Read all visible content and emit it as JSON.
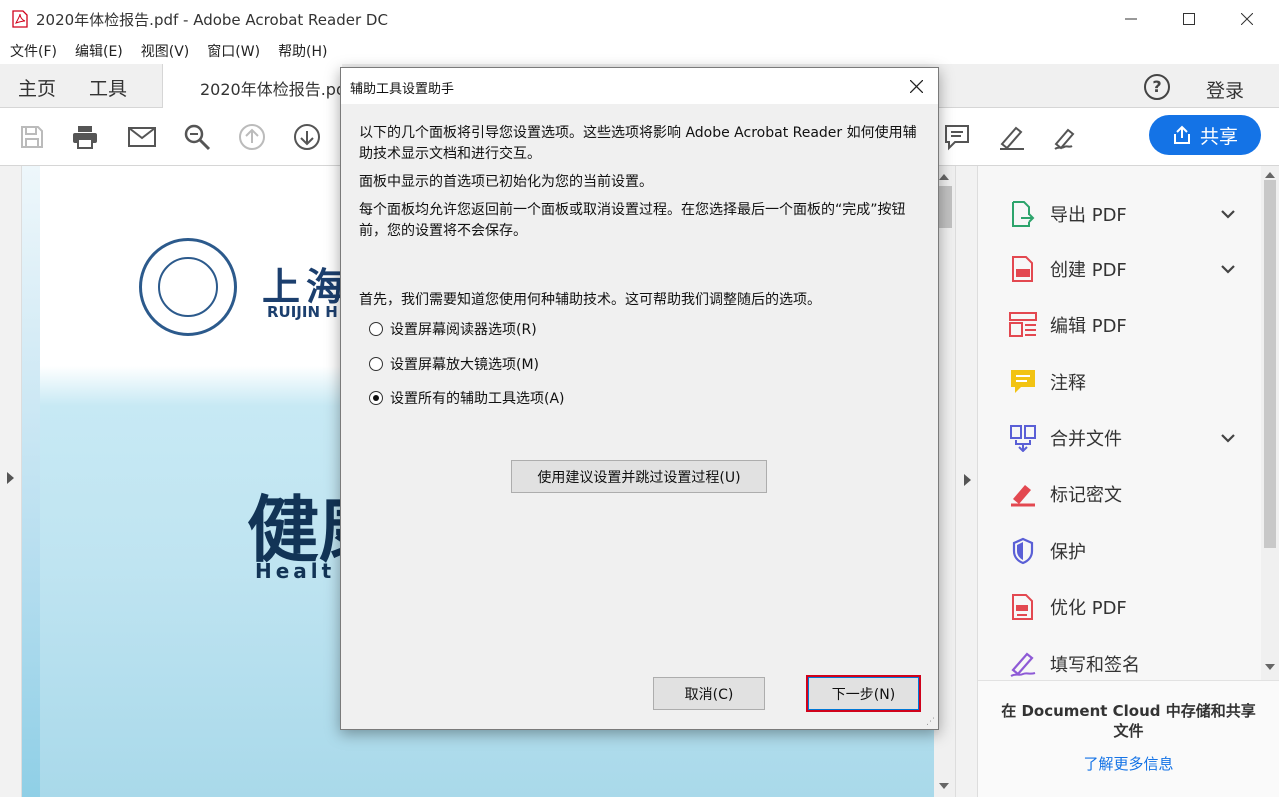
{
  "window": {
    "title": "2020年体检报告.pdf - Adobe Acrobat Reader DC",
    "minimize": "—",
    "maximize": "☐",
    "close": "✕"
  },
  "menu": [
    "文件(F)",
    "编辑(E)",
    "视图(V)",
    "窗口(W)",
    "帮助(H)"
  ],
  "tabs": {
    "home": "主页",
    "tools": "工具",
    "document": "2020年体检报告.pdf",
    "help": "?",
    "login": "登录"
  },
  "toolbar": {
    "icons": [
      "save-icon",
      "print-icon",
      "email-icon",
      "zoom-search-icon",
      "page-up-icon",
      "page-down-icon",
      "comment-icon",
      "highlight-pen-icon",
      "sign-icon"
    ],
    "share_label": "共享",
    "accent": "#1473e6"
  },
  "document": {
    "hospital_cn": "上海",
    "hospital_en": "RUIJIN H",
    "title_cn": "健康",
    "title_en": "Healt"
  },
  "dialog": {
    "title": "辅助工具设置助手",
    "para1": "以下的几个面板将引导您设置选项。这些选项将影响 Adobe Acrobat Reader 如何使用辅助技术显示文档和进行交互。",
    "para2": "面板中显示的首选项已初始化为您的当前设置。",
    "para3": "每个面板均允许您返回前一个面板或取消设置过程。在您选择最后一个面板的“完成”按钮前，您的设置将不会保存。",
    "question": "首先，我们需要知道您使用何种辅助技术。这可帮助我们调整随后的选项。",
    "options": [
      {
        "label": "设置屏幕阅读器选项(R)",
        "selected": false
      },
      {
        "label": "设置屏幕放大镜选项(M)",
        "selected": false
      },
      {
        "label": "设置所有的辅助工具选项(A)",
        "selected": true
      }
    ],
    "skip_button": "使用建议设置并跳过设置过程(U)",
    "cancel_button": "取消(C)",
    "next_button": "下一步(N)"
  },
  "right_panel": {
    "items": [
      {
        "label": "导出 PDF",
        "icon": "export-pdf-icon",
        "color": "#2da46c",
        "expandable": true
      },
      {
        "label": "创建 PDF",
        "icon": "create-pdf-icon",
        "color": "#e34850",
        "expandable": true
      },
      {
        "label": "编辑 PDF",
        "icon": "edit-pdf-icon",
        "color": "#e34850",
        "expandable": false
      },
      {
        "label": "注释",
        "icon": "comment-icon",
        "color": "#f2c313",
        "expandable": false
      },
      {
        "label": "合并文件",
        "icon": "combine-files-icon",
        "color": "#5a5fd6",
        "expandable": true
      },
      {
        "label": "标记密文",
        "icon": "redact-icon",
        "color": "#e34850",
        "expandable": false
      },
      {
        "label": "保护",
        "icon": "protect-shield-icon",
        "color": "#5a5fd6",
        "expandable": false
      },
      {
        "label": "优化 PDF",
        "icon": "optimize-pdf-icon",
        "color": "#e34850",
        "expandable": false
      },
      {
        "label": "填写和签名",
        "icon": "fill-sign-icon",
        "color": "#8e5ad6",
        "expandable": false
      }
    ],
    "footer_message": "在 Document Cloud 中存储和共享文件",
    "footer_link": "了解更多信息"
  }
}
